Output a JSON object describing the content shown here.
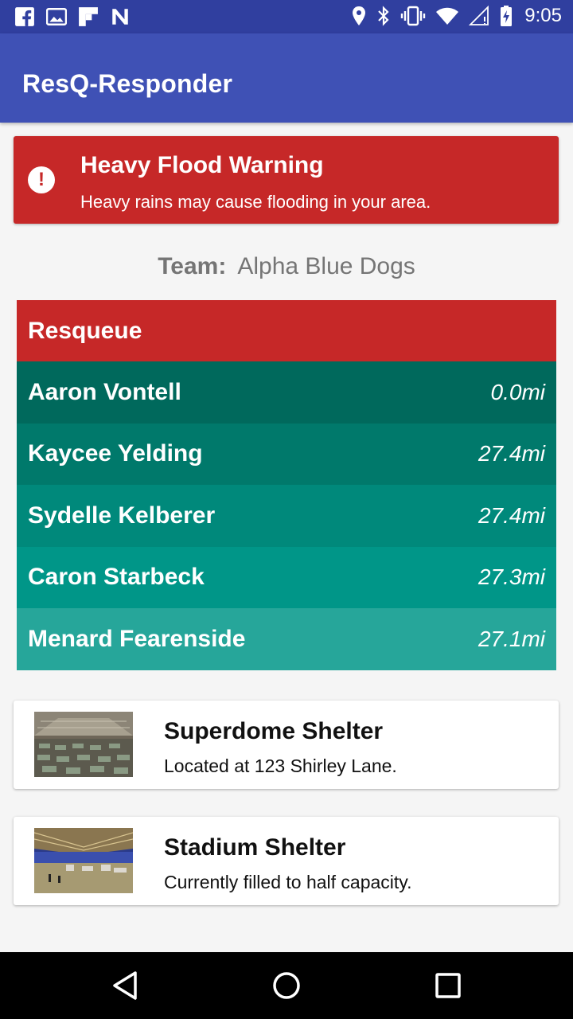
{
  "status_bar": {
    "time": "9:05",
    "left_icons": [
      "facebook-icon",
      "photo-icon",
      "flipboard-icon",
      "n-icon"
    ],
    "right_icons": [
      "location-icon",
      "bluetooth-icon",
      "vibrate-icon",
      "wifi-icon",
      "no-signal-icon",
      "battery-icon"
    ]
  },
  "app_bar": {
    "title": "ResQ-Responder"
  },
  "alert": {
    "icon": "exclamation-icon",
    "title": "Heavy Flood Warning",
    "text": "Heavy rains may cause flooding in your area."
  },
  "team": {
    "label": "Team:",
    "name": "Alpha Blue Dogs"
  },
  "queue": {
    "header": "Resqueue",
    "items": [
      {
        "name": "Aaron Vontell",
        "distance": "0.0mi",
        "color": "#00695c"
      },
      {
        "name": "Kaycee Yelding",
        "distance": "27.4mi",
        "color": "#00796b"
      },
      {
        "name": "Sydelle Kelberer",
        "distance": "27.4mi",
        "color": "#00897b"
      },
      {
        "name": "Caron Starbeck",
        "distance": "27.3mi",
        "color": "#009688"
      },
      {
        "name": "Menard Fearenside",
        "distance": "27.1mi",
        "color": "#26a69a"
      }
    ]
  },
  "shelters": [
    {
      "title": "Superdome Shelter",
      "text": "Located at 123 Shirley Lane."
    },
    {
      "title": "Stadium Shelter",
      "text": "Currently filled to half capacity."
    }
  ],
  "colors": {
    "primary": "#3f51b5",
    "primary_dark": "#303f9f",
    "alert_red": "#c62828"
  },
  "nav": [
    "back-icon",
    "home-icon",
    "recents-icon"
  ]
}
